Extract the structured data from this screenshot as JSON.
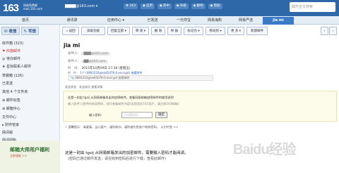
{
  "header": {
    "logo": "163",
    "logo_sub_1": "网易免费邮",
    "logo_sub_2": "mail.163.com",
    "account": "▇▇▇▇@163.com ▾",
    "links": [
      "❖ 163",
      "◆ 应用",
      "◆ 开中",
      "◆ 升级",
      "◆ 解构",
      "◆ 帮助"
    ],
    "search_placeholder": "邮件全文搜索"
  },
  "nav": {
    "tabs": [
      "首页",
      "通讯录",
      "应用中心 ▾",
      "已发送",
      "一元夺宝",
      "网易海购",
      "网易严选",
      "jia mi"
    ]
  },
  "sidebar": {
    "receive": "✉ 收信",
    "compose": "✎ 写信",
    "folders": [
      "收件箱 (323)",
      "⚑ 红旗邮件",
      "◎ 待办邮件",
      "★ 星标联系人邮件",
      "草稿箱 (126)",
      "已发送",
      "其他 4 个文件夹",
      "⊕ 邮件标签",
      "⊕ 邮箱中心",
      "文件中心",
      "▸ 附件管家",
      "网评邮",
      "网评团购"
    ],
    "ad_title": "邮箱大师用户福利",
    "ad_sub": "立即领取 >>"
  },
  "toolbar": {
    "buttons": [
      "« 返回",
      "高级功能",
      "回复全部 ▾",
      "转 发 ▾",
      "删 除",
      "举 报",
      "标记为 ▾",
      "移动到 ▾",
      "更 多 ▾",
      "新建邮件",
      "‹",
      "›"
    ]
  },
  "mail": {
    "subject": "jia mi",
    "from_label": "发件人：",
    "from_value": "▇▇▇@163.com",
    "to_label": "收件人：",
    "to_value": "▇▇@163.com",
    "time_label": "时　间：",
    "time_value": "2015年10月09日 17:38 (星期五)",
    "att_label": "附　件：",
    "att_value": "1个 (0893333@ea65076-0.encrypt) 查看附件",
    "attachment": "📎 0893333@ea65076-0.encrypt 加密邮件",
    "notice": "发送状态：发送成功    查看详情",
    "box_line1": "这是一封由 tgsij 从网易邮箱发出的加密邮件。查看网易邮箱加密邮件的使用说明",
    "box_line2": "输入收件人提供的阅读密码，即可查看邮件内容(若您是非163用户，请注册163邮箱)",
    "box_pwd_label": "输入密码：",
    "box_pwd_placeholder": "已设置密码",
    "box_ok": "确定",
    "safety": "⚡ 温馨提示：请谨慎。当心客户，谨防欺诈。谨防被钓鱼账户收取密码。    认识钓鱼 >>",
    "body_line1": "这是一封由 tgsij 从网易邮箱发出的加密邮件。需要输入密码才能阅读。",
    "body_line2": "(密码已通过邮件发送，请在收到密码后进行下载，查看此邮件)"
  },
  "watermark": "Baidu经验",
  "colors": {
    "header": "#2e68a8",
    "accent": "#3a7bc8",
    "link": "#2a5db0"
  }
}
